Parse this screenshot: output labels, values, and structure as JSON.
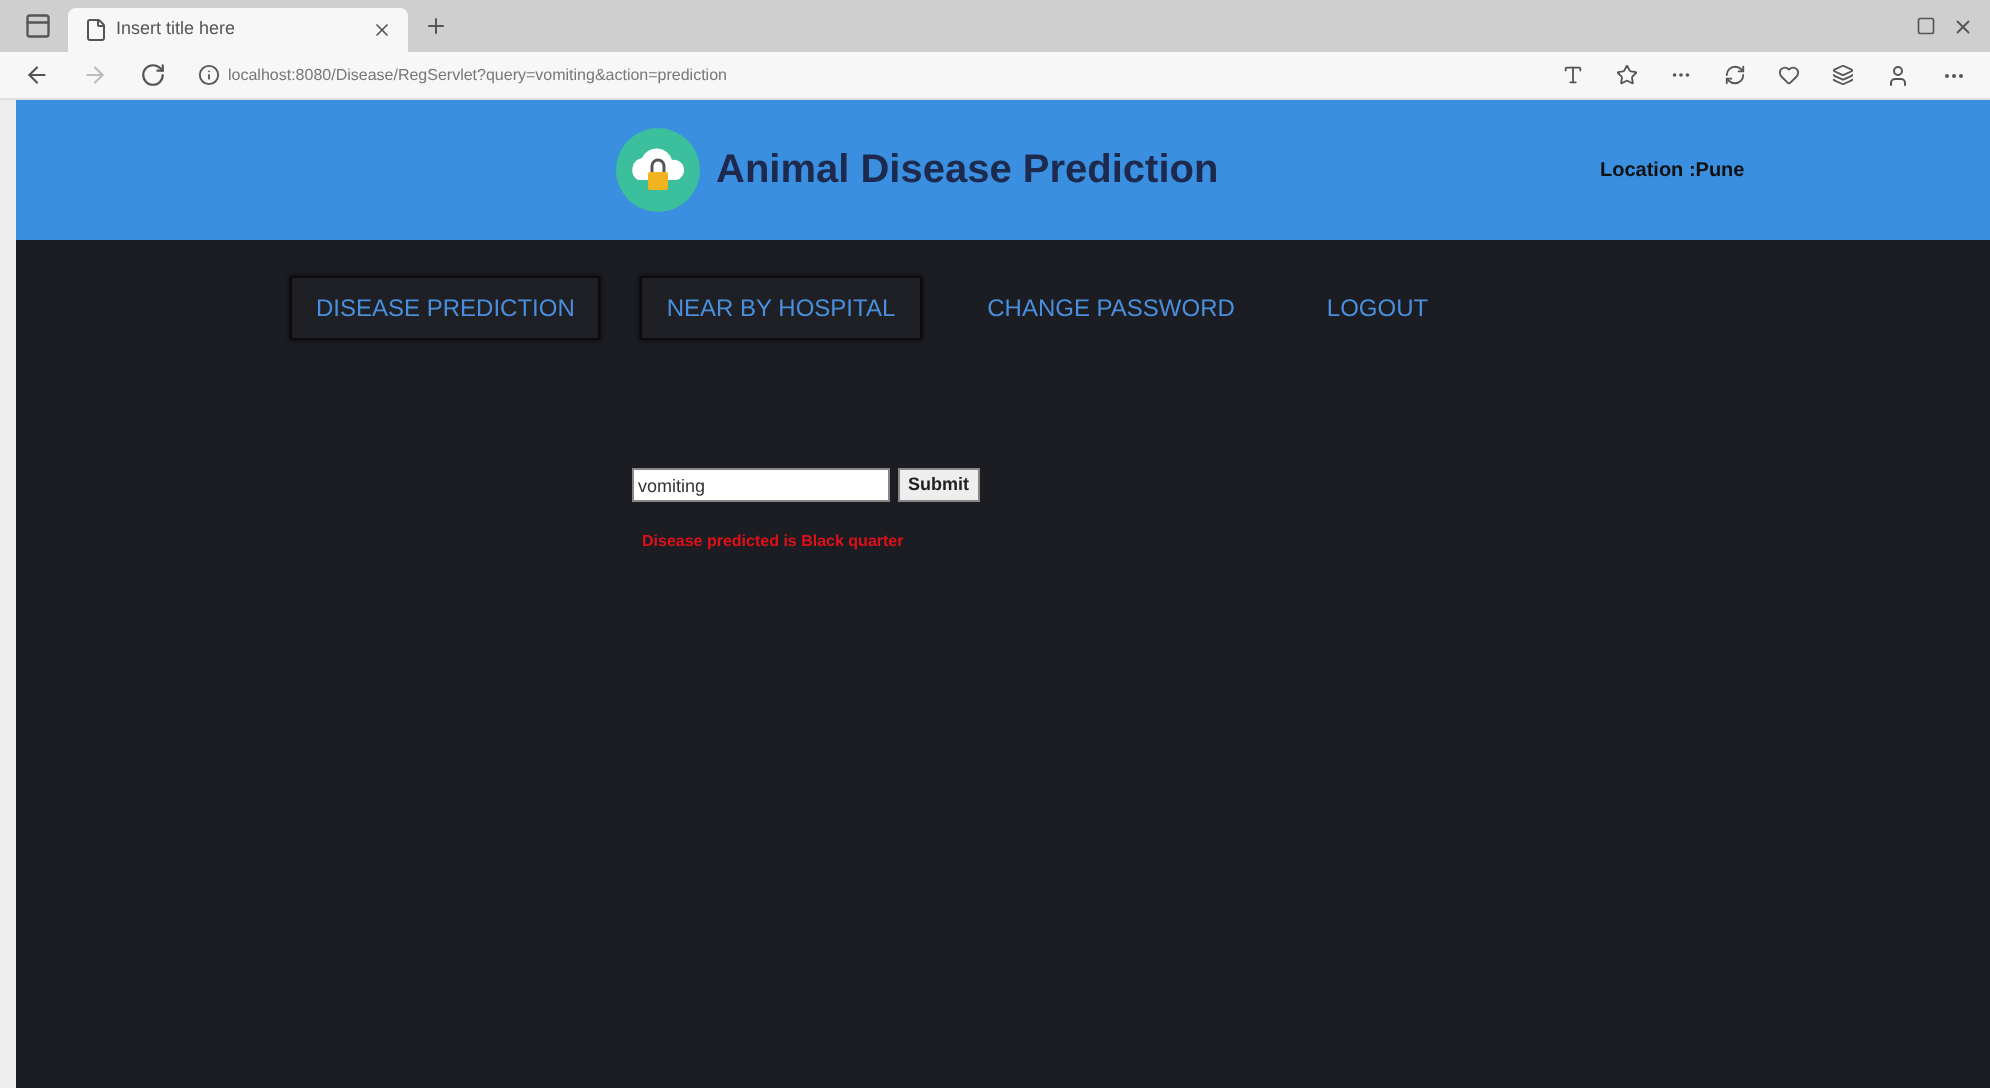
{
  "browser": {
    "tab_title": "Insert title here",
    "address": "localhost:8080/Disease/RegServlet?query=vomiting&action=prediction"
  },
  "header": {
    "title": "Animal Disease Prediction",
    "location": "Location :Pune"
  },
  "nav": [
    {
      "label": "DISEASE PREDICTION",
      "boxed": true
    },
    {
      "label": "NEAR BY HOSPITAL",
      "boxed": true
    },
    {
      "label": "CHANGE PASSWORD",
      "boxed": false
    },
    {
      "label": "LOGOUT",
      "boxed": false
    }
  ],
  "form": {
    "value": "vomiting",
    "button": "Submit",
    "result": "Disease predicted is Black quarter"
  }
}
